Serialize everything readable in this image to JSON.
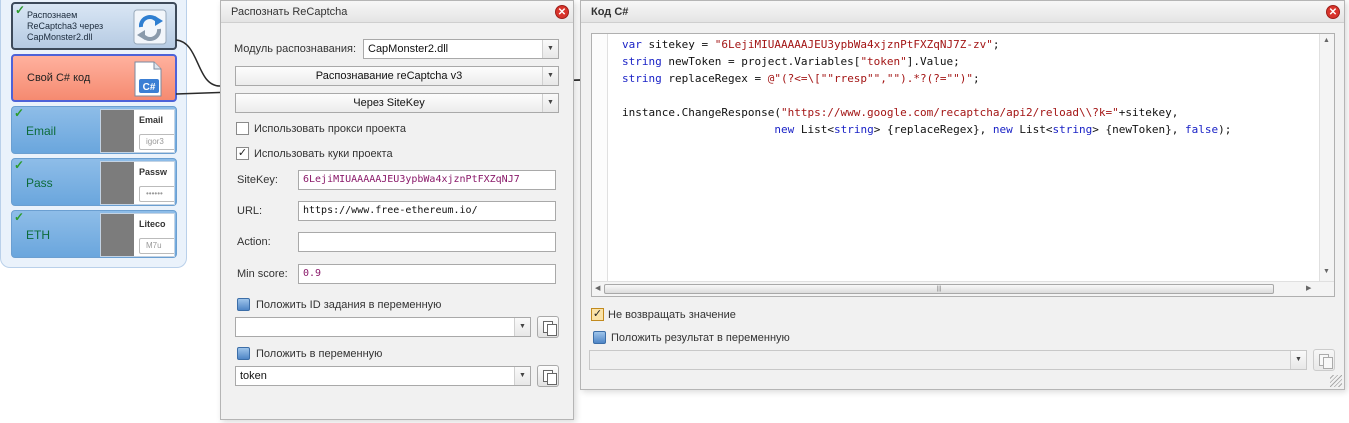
{
  "nodes": {
    "captcha_label": "Распознаем ReCaptcha3 через CapMonster2.dll",
    "csharp_label": "Свой C# код",
    "fields": [
      {
        "label": "Email",
        "thumb_title": "Email",
        "thumb_input": "igor3"
      },
      {
        "label": "Pass",
        "thumb_title": "Passw",
        "thumb_input": "••••••"
      },
      {
        "label": "ETH",
        "thumb_title": "Liteco",
        "thumb_input": "M7u"
      }
    ],
    "check_mark": "✓"
  },
  "recaptcha_dialog": {
    "title": "Распознать ReCaptcha",
    "close": "✕",
    "module_label": "Модуль распознавания:",
    "module_value": "CapMonster2.dll",
    "mode_value": "Распознавание reCaptcha v3",
    "method_value": "Через SiteKey",
    "use_proxy_label": "Использовать прокси проекта",
    "use_proxy_checked": false,
    "use_cookies_label": "Использовать куки проекта",
    "use_cookies_checked": true,
    "sitekey_label": "SiteKey:",
    "sitekey_value": "6LejiMIUAAAAAJEU3ypbWa4xjznPtFXZqNJ7",
    "url_label": "URL:",
    "url_value": "https://www.free-ethereum.io/",
    "action_label": "Action:",
    "action_value": "",
    "min_score_label": "Min score:",
    "min_score_value": "0.9",
    "task_id_label": "Положить ID задания в переменную",
    "task_id_value": "",
    "put_var_label": "Положить в переменную",
    "put_var_value": "token"
  },
  "csharp_dialog": {
    "title": "Код C#",
    "close": "✕",
    "code_lines": [
      [
        {
          "t": "var",
          "c": "kw"
        },
        {
          "t": " sitekey = "
        },
        {
          "t": "\"6LejiMIUAAAAAJEU3ypbWa4xjznPtFXZqNJ7Z-zv\"",
          "c": "str"
        },
        {
          "t": ";"
        }
      ],
      [
        {
          "t": "string",
          "c": "kw"
        },
        {
          "t": " newToken = project.Variables["
        },
        {
          "t": "\"token\"",
          "c": "str"
        },
        {
          "t": "].Value;"
        }
      ],
      [
        {
          "t": "string",
          "c": "kw"
        },
        {
          "t": " replaceRegex = "
        },
        {
          "t": "@\"(?<=\\[\"\"rresp\"\",\"\").*?(?=\"\")\"",
          "c": "str"
        },
        {
          "t": ";"
        }
      ],
      [
        {
          "t": ""
        }
      ],
      [
        {
          "t": "instance.ChangeResponse("
        },
        {
          "t": "\"https://www.google.com/recaptcha/api2/reload\\\\?k=\"",
          "c": "str"
        },
        {
          "t": "+sitekey,"
        }
      ],
      [
        {
          "t": "                       "
        },
        {
          "t": "new",
          "c": "kw"
        },
        {
          "t": " List<"
        },
        {
          "t": "string",
          "c": "kw"
        },
        {
          "t": "> {replaceRegex}, "
        },
        {
          "t": "new",
          "c": "kw"
        },
        {
          "t": " List<"
        },
        {
          "t": "string",
          "c": "kw"
        },
        {
          "t": "> {newToken}, "
        },
        {
          "t": "false",
          "c": "kw"
        },
        {
          "t": ");"
        }
      ]
    ],
    "no_return_label": "Не возвращать значение",
    "no_return_checked": true,
    "put_result_label": "Положить результат в переменную",
    "result_value": ""
  }
}
